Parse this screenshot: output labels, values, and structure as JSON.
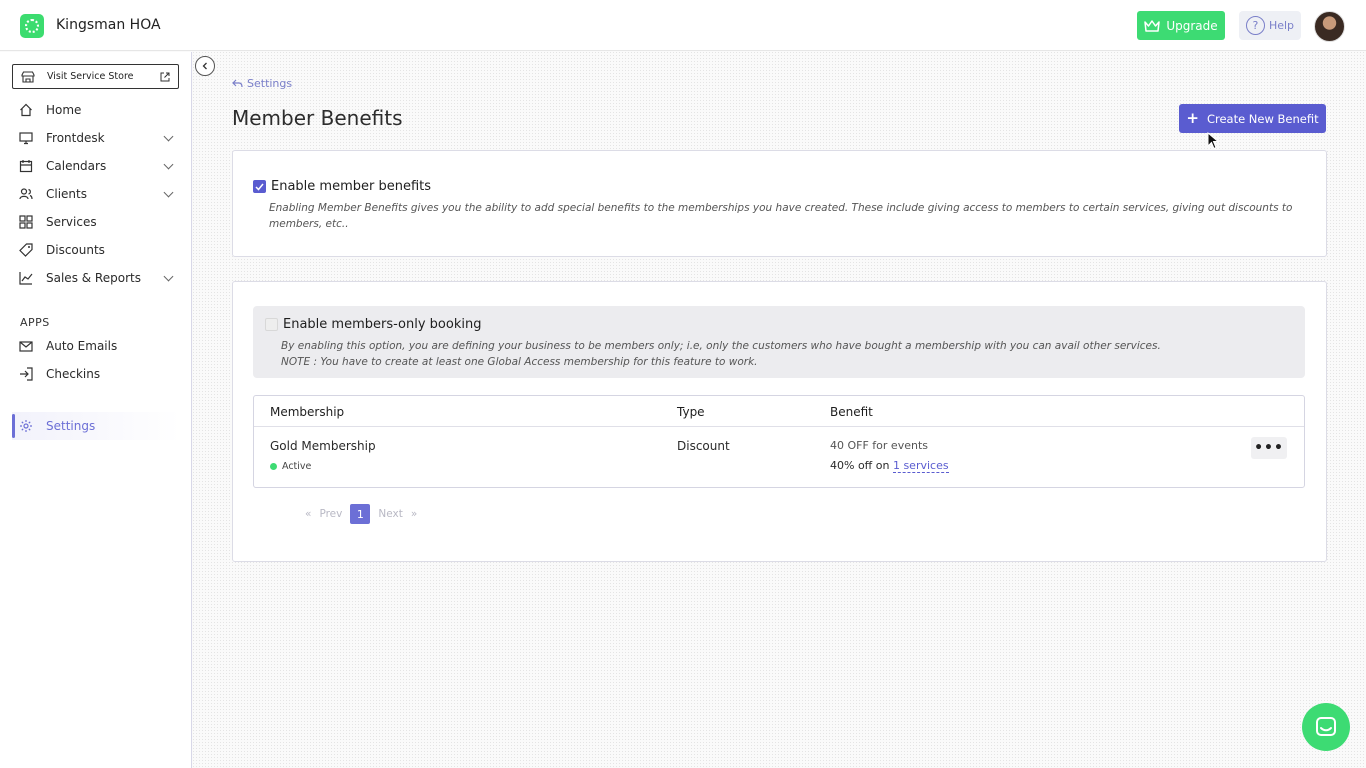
{
  "header": {
    "org_name": "Kingsman HOA",
    "upgrade_label": "Upgrade",
    "help_label": "Help",
    "help_glyph": "?"
  },
  "sidebar": {
    "store_label": "Visit Service Store",
    "items": [
      {
        "label": "Home",
        "icon": "home-icon"
      },
      {
        "label": "Frontdesk",
        "icon": "monitor-icon"
      },
      {
        "label": "Calendars",
        "icon": "calendar-icon"
      },
      {
        "label": "Clients",
        "icon": "users-icon"
      },
      {
        "label": "Services",
        "icon": "grid-icon"
      },
      {
        "label": "Discounts",
        "icon": "tag-icon"
      },
      {
        "label": "Sales & Reports",
        "icon": "chart-icon"
      }
    ],
    "apps_title": "APPS",
    "apps": [
      {
        "label": "Auto Emails",
        "icon": "mail-icon"
      },
      {
        "label": "Checkins",
        "icon": "login-icon"
      }
    ],
    "settings_label": "Settings"
  },
  "main": {
    "breadcrumb": "Settings",
    "title": "Member Benefits",
    "create_label": "Create New Benefit",
    "benefits": {
      "title": "Enable member benefits",
      "checked": true,
      "desc": "Enabling Member Benefits gives you the ability to add special benefits to the memberships you have created. These include giving access to members to certain services, giving out discounts to members, etc.."
    },
    "members_only": {
      "title": "Enable members-only booking",
      "checked": false,
      "desc1": "By enabling this option, you are defining your business to be members only; i.e, only the customers who have bought a membership with you can avail other services.",
      "desc2": "NOTE : You have to create at least one Global Access membership for this feature to work."
    },
    "table": {
      "headers": [
        "Membership",
        "Type",
        "Benefit"
      ],
      "rows": [
        {
          "name": "Gold Membership",
          "status": "Active",
          "type": "Discount",
          "benefit1": "40 OFF for events",
          "benefit2_prefix": "40% off on ",
          "benefit2_link": "1 services",
          "more": "•••"
        }
      ]
    },
    "pagination": {
      "first": "«",
      "prev": "Prev",
      "page": "1",
      "next": "Next",
      "last": "»"
    }
  },
  "colors": {
    "accent": "#5a5cd0",
    "brand_green": "#3ddb73"
  }
}
